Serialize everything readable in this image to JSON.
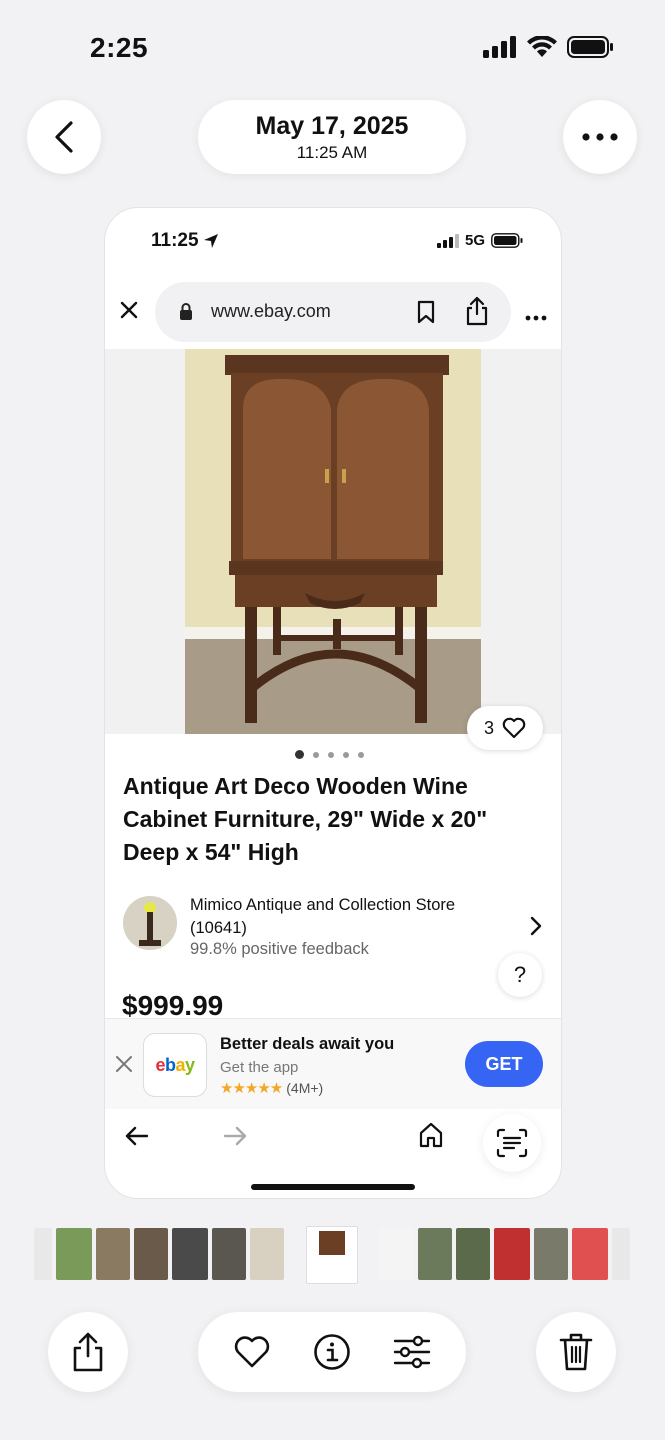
{
  "device_status": {
    "time": "2:25"
  },
  "header": {
    "date": "May 17, 2025",
    "time": "11:25 AM"
  },
  "screenshot": {
    "status": {
      "time": "11:25",
      "network": "5G"
    },
    "browser": {
      "url": "www.ebay.com"
    },
    "listing": {
      "likes": "3",
      "title": "Antique Art Deco Wooden Wine Cabinet Furniture, 29\" Wide x 20\" Deep x 54\" High",
      "seller_name": "Mimico Antique and Collection Store (10641)",
      "seller_feedback": "99.8% positive feedback",
      "help": "?",
      "price": "$999.99",
      "image_dots": 5,
      "active_dot": 0
    },
    "app_banner": {
      "logo_text": "ebay",
      "title": "Better deals await you",
      "subtitle": "Get the app",
      "stars": "★★★★★",
      "rating_count": "(4M+)",
      "cta": "GET"
    }
  },
  "colors": {
    "accent": "#3665f3",
    "star": "#f5a623",
    "background": "#f2f2f4"
  }
}
